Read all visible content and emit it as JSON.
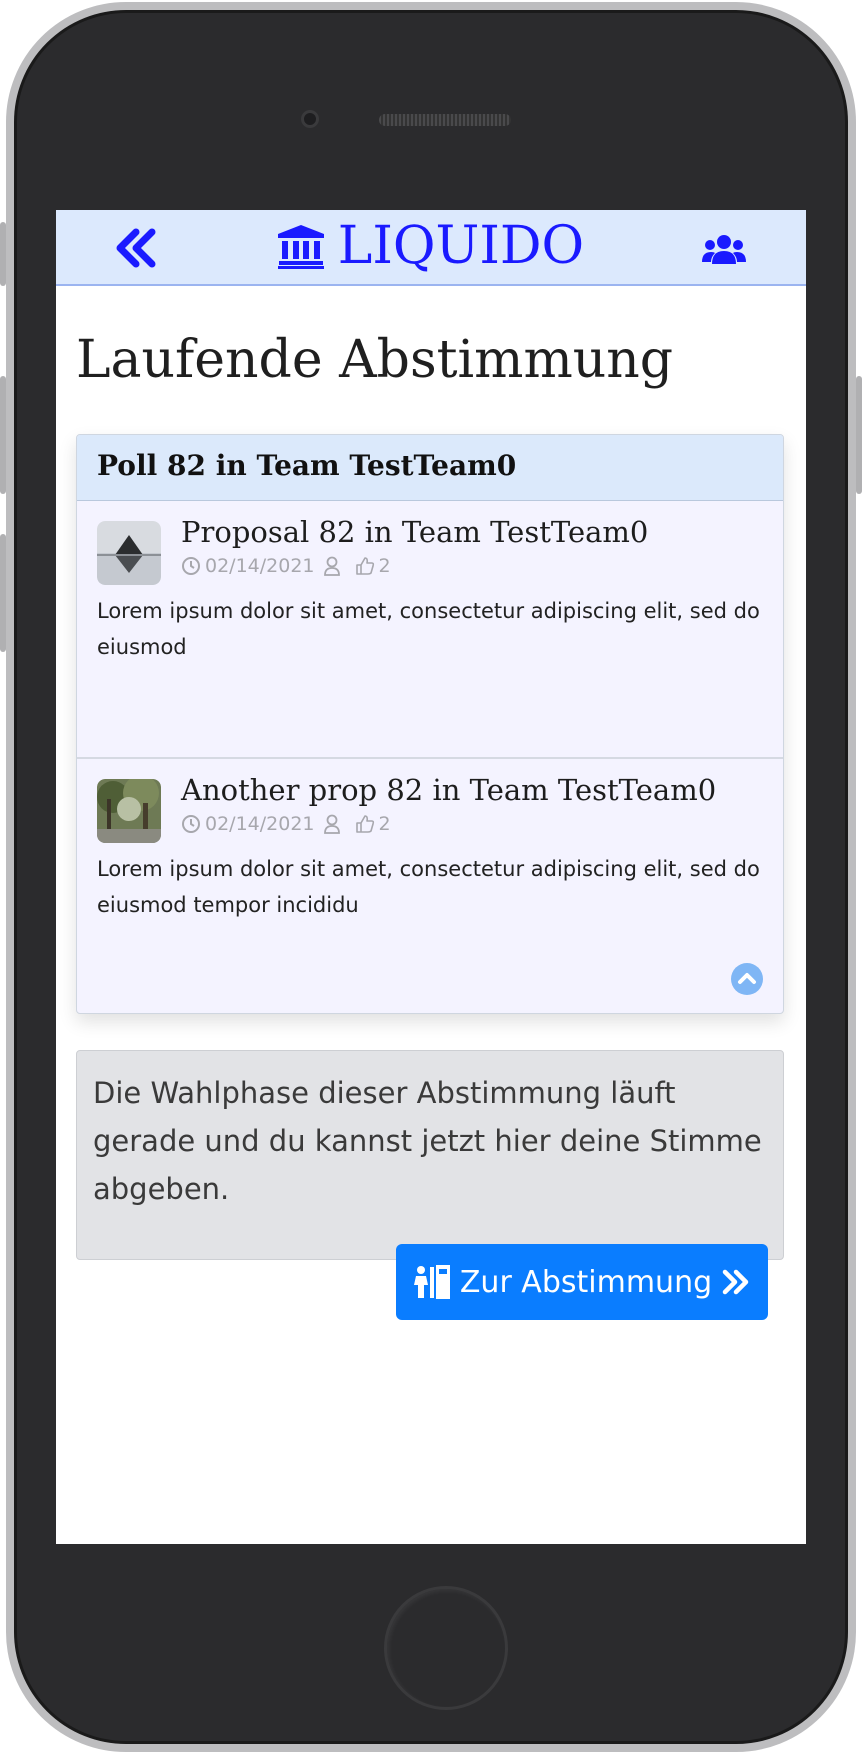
{
  "navbar": {
    "brand": "LIQUIDO",
    "back_icon": "double-chevron-left-icon",
    "brand_icon": "bank-building-icon",
    "team_icon": "users-icon",
    "background": "#dce9fd",
    "accent": "#1a1aff"
  },
  "page": {
    "title": "Laufende Abstimmung"
  },
  "poll": {
    "header": "Poll 82 in Team TestTeam0",
    "proposals": [
      {
        "title": "Proposal 82 in Team TestTeam0",
        "date": "02/14/2021",
        "likes": "2",
        "description": "Lorem ipsum dolor sit amet, consectetur adipiscing elit, sed do eiusmod"
      },
      {
        "title": "Another prop 82 in Team TestTeam0",
        "date": "02/14/2021",
        "likes": "2",
        "description": "Lorem ipsum dolor sit amet, consectetur adipiscing elit, sed do eiusmod tempor incididu"
      }
    ]
  },
  "info": {
    "text": "Die Wahlphase dieser Abstimmung läuft gerade und du kannst jetzt hier deine Stimme abgeben."
  },
  "vote_button": {
    "label": "Zur Abstimmung",
    "color": "#0a7dff"
  }
}
